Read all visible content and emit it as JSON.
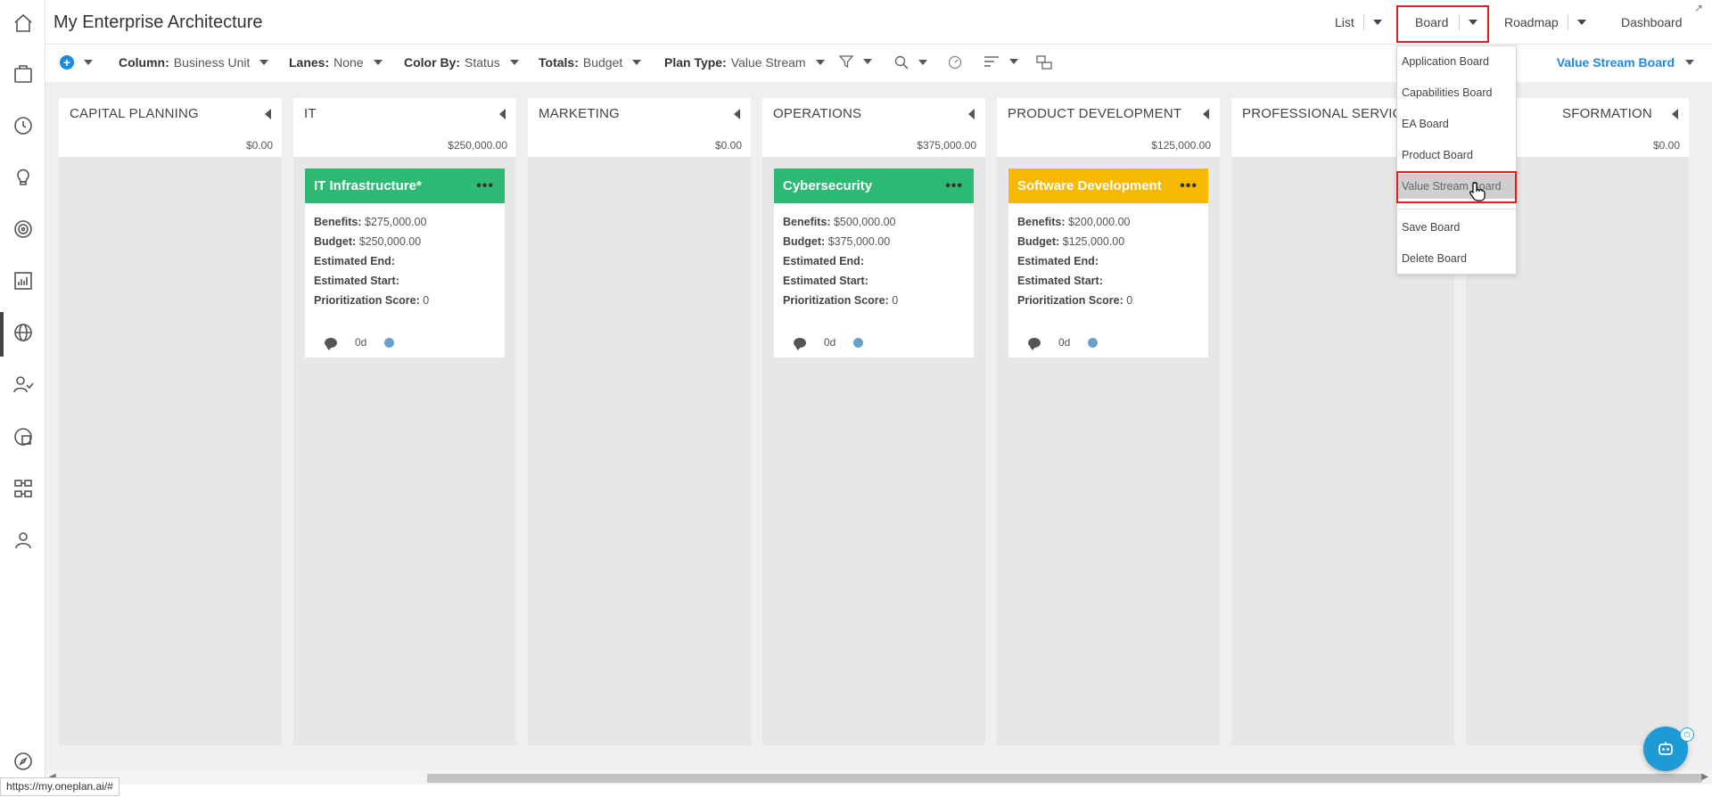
{
  "app": {
    "title": "My Enterprise Architecture",
    "status_url": "https://my.oneplan.ai/#"
  },
  "rail": {
    "icons": [
      "home-icon",
      "briefcase-icon",
      "history-icon",
      "lightbulb-icon",
      "target-icon",
      "chart-icon",
      "globe-icon",
      "users-icon",
      "finance-icon",
      "hierarchy-icon",
      "person-icon",
      "compass-icon"
    ]
  },
  "topnav": {
    "list_label": "List",
    "board_label": "Board",
    "roadmap_label": "Roadmap",
    "dashboard_label": "Dashboard"
  },
  "toolbar": {
    "column_key": "Column:",
    "column_value": "Business Unit",
    "lanes_key": "Lanes:",
    "lanes_value": "None",
    "color_key": "Color By:",
    "color_value": "Status",
    "totals_key": "Totals:",
    "totals_value": "Budget",
    "plantype_key": "Plan Type:",
    "plantype_value": "Value Stream",
    "current_board": "Value Stream Board"
  },
  "board_menu": {
    "items": [
      "Application Board",
      "Capabilities Board",
      "EA Board",
      "Product Board",
      "Value Stream Board"
    ],
    "actions": [
      "Save Board",
      "Delete Board"
    ],
    "selected": "Value Stream Board"
  },
  "columns": [
    {
      "title": "CAPITAL PLANNING",
      "total": "$0.00"
    },
    {
      "title": "IT",
      "total": "$250,000.00"
    },
    {
      "title": "MARKETING",
      "total": "$0.00"
    },
    {
      "title": "OPERATIONS",
      "total": "$375,000.00"
    },
    {
      "title": "PRODUCT DEVELOPMENT",
      "total": "$125,000.00"
    },
    {
      "title": "PROFESSIONAL SERVICES",
      "total": ""
    },
    {
      "title": "SFORMATION",
      "total": "$0.00"
    }
  ],
  "card_labels": {
    "benefits": "Benefits:",
    "budget": "Budget:",
    "est_end": "Estimated End:",
    "est_start": "Estimated Start:",
    "prio": "Prioritization Score:"
  },
  "cards": [
    {
      "title": "IT Infrastructure*",
      "color": "#2dba74",
      "benefits": "$275,000.00",
      "budget": "$250,000.00",
      "est_end": "",
      "est_start": "",
      "prio": "0",
      "duration": "0d",
      "status_color": "#6a9fc9"
    },
    {
      "title": "Cybersecurity",
      "color": "#2dba74",
      "benefits": "$500,000.00",
      "budget": "$375,000.00",
      "est_end": "",
      "est_start": "",
      "prio": "0",
      "duration": "0d",
      "status_color": "#6a9fc9"
    },
    {
      "title": "Software Development",
      "color": "#f7b900",
      "benefits": "$200,000.00",
      "budget": "$125,000.00",
      "est_end": "",
      "est_start": "",
      "prio": "0",
      "duration": "0d",
      "status_color": "#6a9fc9"
    }
  ],
  "colors": {
    "accent": "#1e88e5",
    "highlight": "#e02020"
  }
}
